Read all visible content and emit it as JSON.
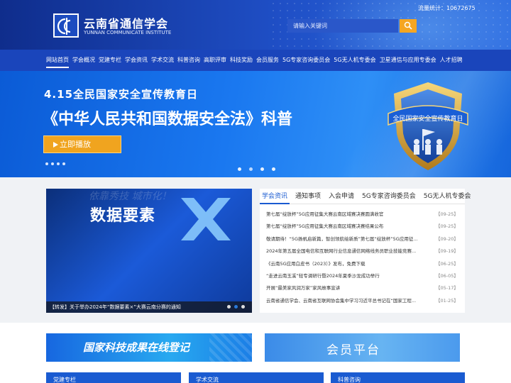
{
  "header": {
    "org_name_cn": "云南省通信学会",
    "org_name_en": "YUNNAN COMMUNICATE INSTITUTE",
    "visits": "流量统计：10672675",
    "search_placeholder": "请输入关键词",
    "colors": {
      "header_bg": "#1f4fc6",
      "search_btn": "#f5a623"
    }
  },
  "nav": {
    "items": [
      {
        "label": "网站首页",
        "active": true
      },
      {
        "label": "学会概况"
      },
      {
        "label": "党建专栏"
      },
      {
        "label": "学会资讯"
      },
      {
        "label": "学术交流"
      },
      {
        "label": "科普咨询"
      },
      {
        "label": "高职评审"
      },
      {
        "label": "科技奖励"
      },
      {
        "label": "会员服务"
      },
      {
        "label": "5G专家咨询委员会"
      },
      {
        "label": "5G无人机专委会"
      },
      {
        "label": "卫星通信与应用专委会"
      },
      {
        "label": "人才招聘"
      }
    ]
  },
  "banner": {
    "subtitle": "4.15全民国家安全宣传教育日",
    "title": "《中华人民共和国数据安全法》科普",
    "play_label": "立即播放",
    "badge_text": "全民国家安全宣传教育日",
    "slide_count": 4,
    "active_slide": 2
  },
  "news_image": {
    "faint_text": "依靠秀技 城市化！",
    "big_text": "数据要素",
    "caption": "【转发】关于举办2024年“数据要素×”大赛云南分赛的通知",
    "slide_count": 3,
    "active_slide": 2
  },
  "panel": {
    "tabs": [
      "学会资讯",
      "通知事项",
      "入会申请",
      "5G专家咨询委员会",
      "5G无人机专委会"
    ],
    "active_tab": 0,
    "items": [
      {
        "title": "第七届“绽放杯”5G应用征集大赛云南区域赛决赛圆满收官",
        "date": "【09-25】"
      },
      {
        "title": "第七届“绽放杯”5G应用征集大赛云南区域赛决赛结果公布",
        "date": "【09-25】"
      },
      {
        "title": "敬请期待！“5G扬帆启新篇，智创领航绘新质”第七届“绽放杯”5G应用征...",
        "date": "【09-20】"
      },
      {
        "title": "2024年第五届全国电信和互联网行业信息通信网络线务员职业技能竞赛...",
        "date": "【09-19】"
      },
      {
        "title": "《云南5G应用白皮书（2023）》发布，免费下载",
        "date": "【06-25】"
      },
      {
        "title": "“走进云南玉溪”轻专调研行暨2024年夏季沙龙成功举行",
        "date": "【06-05】"
      },
      {
        "title": "开展“最美家风润万家”家风故事宣讲",
        "date": "【05-17】"
      },
      {
        "title": "云南省通信学会、云南省互联网协会集中学习习近平总书记在“国家工程...",
        "date": "【01-25】"
      }
    ]
  },
  "promos": {
    "left": "国家科技成果在线登记",
    "right": "会员平台"
  },
  "cards": [
    "党建专栏",
    "学术交流",
    "科普咨询"
  ]
}
